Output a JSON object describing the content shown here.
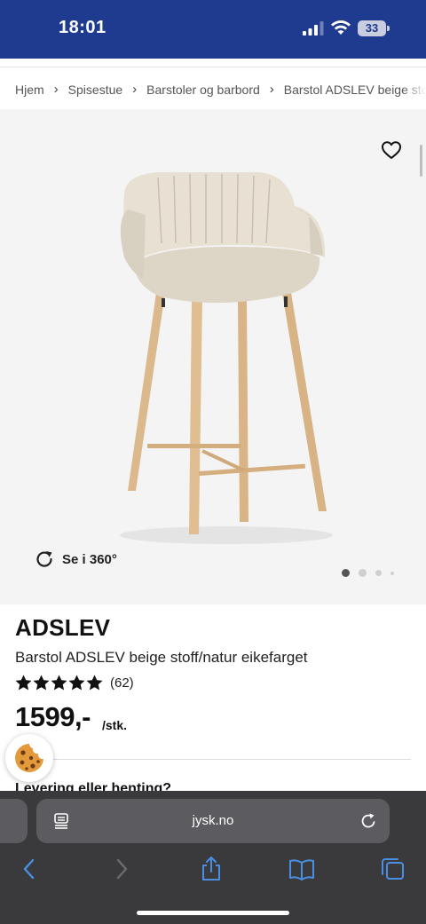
{
  "status_bar": {
    "time": "18:01",
    "battery": "33",
    "background": "#1f3b8f",
    "icons": [
      "cellular-signal-icon",
      "wifi-icon",
      "battery-icon"
    ]
  },
  "breadcrumb": {
    "items": [
      "Hjem",
      "Spisestue",
      "Barstoler og barbord",
      "Barstol ADSLEV beige stoff/natur eikefarget"
    ],
    "separator": "›"
  },
  "gallery": {
    "view360_label": "Se i 360°",
    "slide_count": 4,
    "active_slide": 1,
    "icons": [
      "heart-icon",
      "rotate-360-icon"
    ]
  },
  "product": {
    "title": "ADSLEV",
    "subtitle": "Barstol ADSLEV beige stoff/natur eikefarget",
    "rating_stars": 5,
    "rating_count": "(62)",
    "price": "1599,-",
    "unit": "/stk.",
    "delivery_heading": "Levering eller henting?"
  },
  "browser": {
    "url": "jysk.no",
    "icons": [
      "reader-mode-icon",
      "reload-icon",
      "back-icon",
      "forward-icon",
      "share-icon",
      "bookmarks-icon",
      "tabs-icon"
    ],
    "accent": "#4a90e2"
  },
  "cookie": {
    "icon": "cookie-icon"
  }
}
